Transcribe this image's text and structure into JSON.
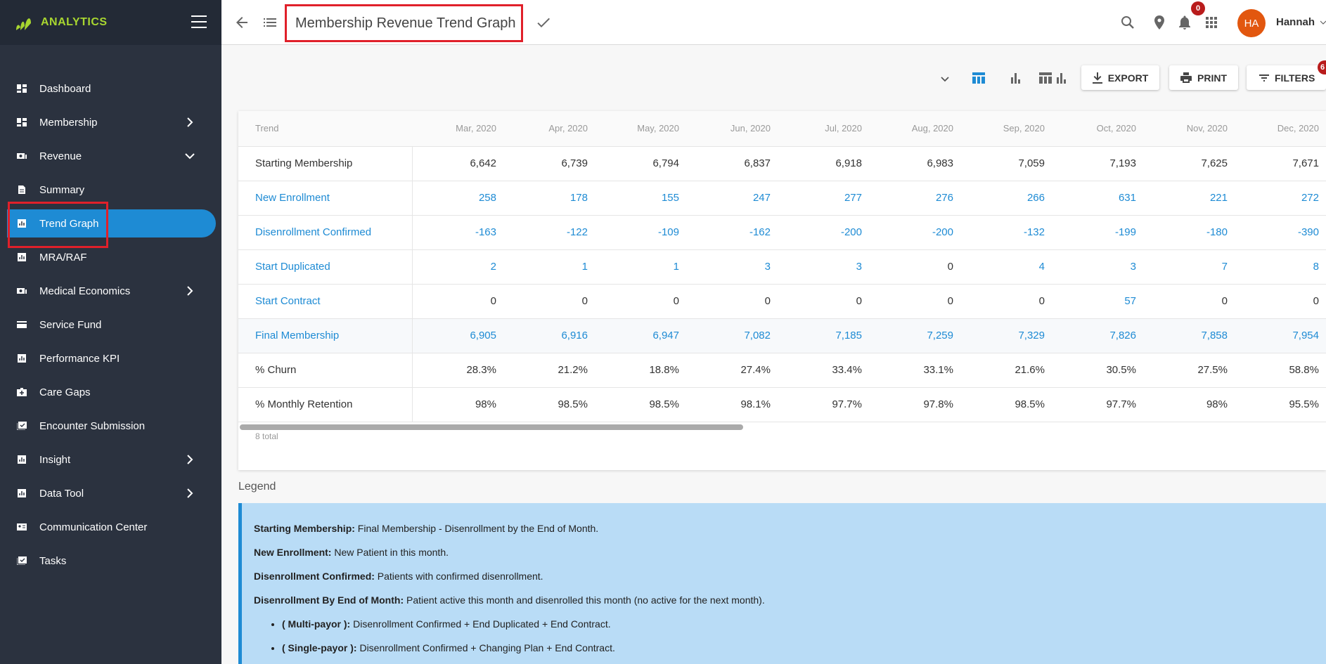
{
  "brand": {
    "name": "ANALYTICS",
    "accent": "#a8d630"
  },
  "sidebar": {
    "items": [
      {
        "label": "Dashboard",
        "icon": "dashboard-icon"
      },
      {
        "label": "Membership",
        "icon": "dashboard-icon",
        "chevron": "right"
      },
      {
        "label": "Revenue",
        "icon": "revenue-icon",
        "chevron": "down"
      },
      {
        "label": "Summary",
        "icon": "document-icon"
      },
      {
        "label": "Trend Graph",
        "icon": "chart-icon",
        "active": true
      },
      {
        "label": "MRA/RAF",
        "icon": "chart-icon"
      },
      {
        "label": "Medical Economics",
        "icon": "revenue-icon",
        "chevron": "right"
      },
      {
        "label": "Service Fund",
        "icon": "card-icon"
      },
      {
        "label": "Performance KPI",
        "icon": "chart-icon"
      },
      {
        "label": "Care Gaps",
        "icon": "medkit-icon"
      },
      {
        "label": "Encounter Submission",
        "icon": "checklist-icon"
      },
      {
        "label": "Insight",
        "icon": "chart-icon",
        "chevron": "right"
      },
      {
        "label": "Data Tool",
        "icon": "chart-icon",
        "chevron": "right"
      },
      {
        "label": "Communication Center",
        "icon": "contact-card-icon"
      },
      {
        "label": "Tasks",
        "icon": "checklist-icon"
      }
    ]
  },
  "header": {
    "title": "Membership Revenue Trend Graph",
    "notification_count": "0",
    "avatar_initials": "HA",
    "username": "Hannah"
  },
  "toolbar": {
    "export_label": "EXPORT",
    "print_label": "PRINT",
    "filters_label": "FILTERS",
    "filters_badge": "6"
  },
  "table": {
    "columns": [
      "Trend",
      "Mar, 2020",
      "Apr, 2020",
      "May, 2020",
      "Jun, 2020",
      "Jul, 2020",
      "Aug, 2020",
      "Sep, 2020",
      "Oct, 2020",
      "Nov, 2020",
      "Dec, 2020"
    ],
    "rows": [
      {
        "label": "Starting Membership",
        "values": [
          "6,642",
          "6,739",
          "6,794",
          "6,837",
          "6,918",
          "6,983",
          "7,059",
          "7,193",
          "7,625",
          "7,671"
        ],
        "style": ""
      },
      {
        "label": "New Enrollment",
        "values": [
          "258",
          "178",
          "155",
          "247",
          "277",
          "276",
          "266",
          "631",
          "221",
          "272"
        ],
        "style": "link"
      },
      {
        "label": "Disenrollment Confirmed",
        "values": [
          "-163",
          "-122",
          "-109",
          "-162",
          "-200",
          "-200",
          "-132",
          "-199",
          "-180",
          "-390"
        ],
        "style": "link"
      },
      {
        "label": "Start Duplicated",
        "values": [
          "2",
          "1",
          "1",
          "3",
          "3",
          "0",
          "4",
          "3",
          "7",
          "8"
        ],
        "style": "link-mixed",
        "link_mask": [
          1,
          1,
          1,
          1,
          1,
          0,
          1,
          1,
          1,
          1
        ]
      },
      {
        "label": "Start Contract",
        "values": [
          "0",
          "0",
          "0",
          "0",
          "0",
          "0",
          "0",
          "57",
          "0",
          "0"
        ],
        "style": "label-link",
        "link_mask": [
          0,
          0,
          0,
          0,
          0,
          0,
          0,
          1,
          0,
          0
        ]
      },
      {
        "label": "Final Membership",
        "values": [
          "6,905",
          "6,916",
          "6,947",
          "7,082",
          "7,185",
          "7,259",
          "7,329",
          "7,826",
          "7,858",
          "7,954"
        ],
        "style": "link shade"
      },
      {
        "label": "% Churn",
        "values": [
          "28.3%",
          "21.2%",
          "18.8%",
          "27.4%",
          "33.4%",
          "33.1%",
          "21.6%",
          "30.5%",
          "27.5%",
          "58.8%"
        ],
        "style": ""
      },
      {
        "label": "% Monthly Retention",
        "values": [
          "98%",
          "98.5%",
          "98.5%",
          "98.1%",
          "97.7%",
          "97.8%",
          "98.5%",
          "97.7%",
          "98%",
          "95.5%"
        ],
        "style": ""
      }
    ],
    "total_text": "8 total"
  },
  "legend": {
    "title": "Legend",
    "entries": [
      {
        "term": "Starting Membership:",
        "desc": " Final Membership - Disenrollment by the End of Month."
      },
      {
        "term": "New Enrollment:",
        "desc": " New Patient in this month."
      },
      {
        "term": "Disenrollment Confirmed:",
        "desc": " Patients with confirmed disenrollment."
      },
      {
        "term": "Disenrollment By End of Month:",
        "desc": " Patient active this month and disenrolled this month (no active for the next month)."
      }
    ],
    "sub_entries": [
      {
        "term": "( Multi-payor ):",
        "desc": " Disenrollment Confirmed + End Duplicated + End Contract."
      },
      {
        "term": "( Single-payor ):",
        "desc": " Disenrollment Confirmed + Changing Plan + End Contract."
      }
    ]
  },
  "colors": {
    "sidebar": "#2b323f",
    "active": "#1e8bd4",
    "link": "#1e8bd4",
    "highlight": "#e0202a",
    "legend_bg": "#b9dcf6"
  }
}
